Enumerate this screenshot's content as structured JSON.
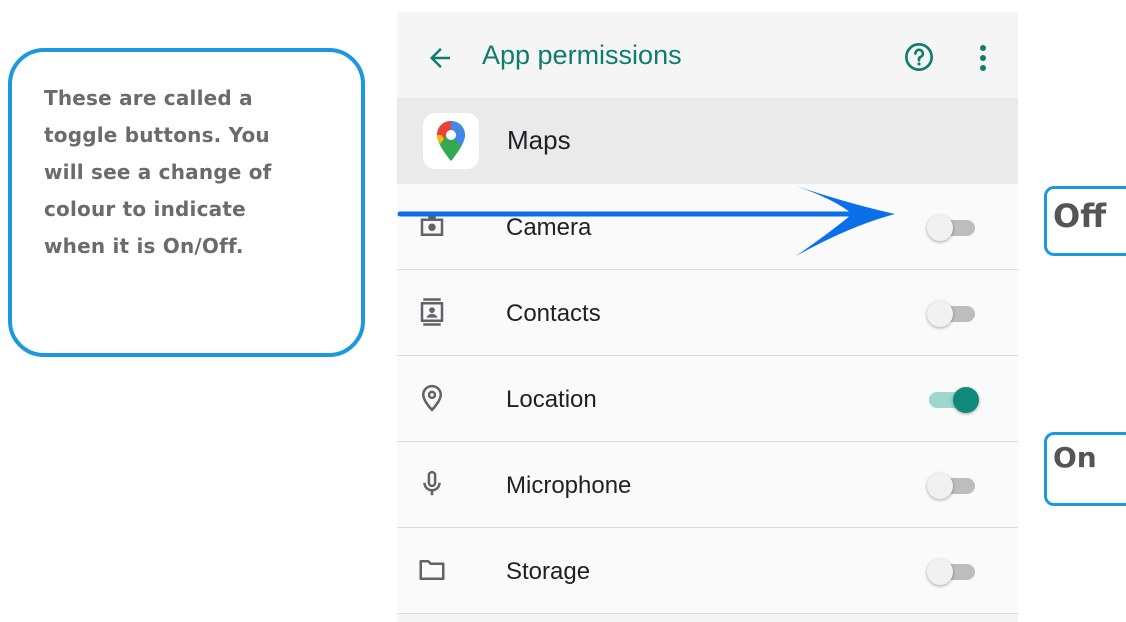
{
  "callout": {
    "text": "These are called a\ntoggle buttons. You\nwill see a change of\ncolour to indicate\nwhen it is On/Off."
  },
  "appbar": {
    "title": "App permissions",
    "back_icon": "arrow-left-icon",
    "help_icon": "help-circle-icon",
    "more_icon": "more-vert-icon"
  },
  "app": {
    "name": "Maps",
    "icon": "google-maps-logo"
  },
  "permissions": [
    {
      "label": "Camera",
      "icon": "camera-icon",
      "enabled": false
    },
    {
      "label": "Contacts",
      "icon": "contacts-icon",
      "enabled": false
    },
    {
      "label": "Location",
      "icon": "location-pin-icon",
      "enabled": true
    },
    {
      "label": "Microphone",
      "icon": "microphone-icon",
      "enabled": false
    },
    {
      "label": "Storage",
      "icon": "folder-icon",
      "enabled": false
    }
  ],
  "annotations": {
    "off_label": "Off",
    "on_label": "On"
  },
  "colors": {
    "accent": "#0d7d6c",
    "toggle_on_thumb": "#10897a",
    "toggle_on_track": "#9ed7cf",
    "toggle_off_track": "#bdbdbd",
    "callout_border": "#1b98e0",
    "arrow": "#0a6fe8"
  }
}
